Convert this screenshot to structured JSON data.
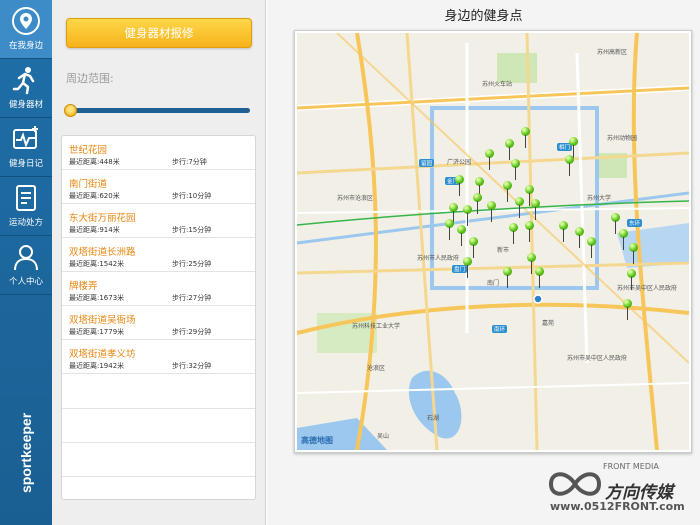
{
  "nav": {
    "items": [
      {
        "label": "在我身边",
        "icon": "location-pin-icon"
      },
      {
        "label": "健身器材",
        "icon": "runner-icon"
      },
      {
        "label": "健身日记",
        "icon": "diary-pulse-icon"
      },
      {
        "label": "运动处方",
        "icon": "prescription-icon"
      },
      {
        "label": "个人中心",
        "icon": "user-icon"
      }
    ],
    "brand": "sportkeeper"
  },
  "panel": {
    "repair_button": "健身器材报修",
    "range_label": "周边范围:",
    "range_value": 0.0,
    "places": [
      {
        "name": "世纪花园",
        "distance": "最近距离:448米",
        "walk": "步行:7分钟"
      },
      {
        "name": "南门街道",
        "distance": "最近距离:620米",
        "walk": "步行:10分钟"
      },
      {
        "name": "东大街万丽花园",
        "distance": "最近距离:914米",
        "walk": "步行:15分钟"
      },
      {
        "name": "双塔街道长洲路",
        "distance": "最近距离:1542米",
        "walk": "步行:25分钟"
      },
      {
        "name": "牌楼弄",
        "distance": "最近距离:1673米",
        "walk": "步行:27分钟"
      },
      {
        "name": "双塔街道吴衙场",
        "distance": "最近距离:1779米",
        "walk": "步行:29分钟"
      },
      {
        "name": "双塔街道孝义坊",
        "distance": "最近距离:1942米",
        "walk": "步行:32分钟"
      }
    ]
  },
  "main": {
    "title": "身边的健身点",
    "map": {
      "labels": [
        "苏州火车站",
        "苏州高新区",
        "苏州动物园",
        "苏州大学",
        "苏州市吴中区人民政府",
        "苏州科技工业大学",
        "广济公园",
        "新市",
        "苏州市人民政府",
        "苏州市吴中区人民政府",
        "苏州市沧浪区",
        "吴山",
        "石湖",
        "嘉苑",
        "南门",
        "沧浪区"
      ],
      "badges": [
        "留园",
        "相门",
        "金门",
        "盘门",
        "东环",
        "南环"
      ],
      "credit": "高德地图"
    }
  },
  "watermark": {
    "top": "FRONT MEDIA",
    "big": "方向传媒",
    "url": "www.0512FRONT.com"
  }
}
